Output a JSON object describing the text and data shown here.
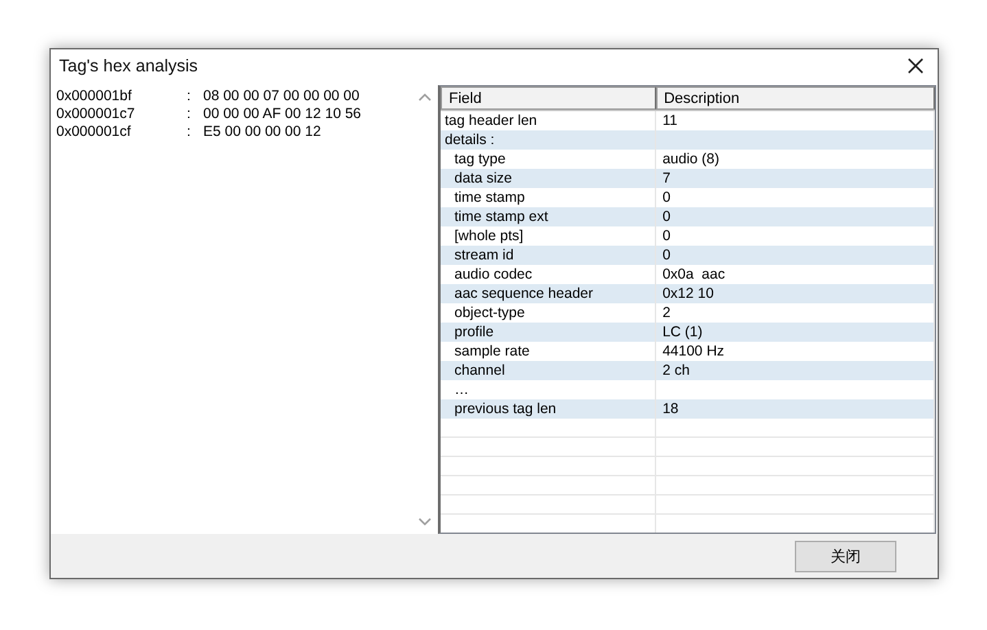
{
  "window": {
    "title": "Tag's hex analysis"
  },
  "hex_lines": [
    {
      "address": "0x000001bf",
      "separator": ":",
      "bytes": "08 00 00 07 00 00 00 00"
    },
    {
      "address": "0x000001c7",
      "separator": ":",
      "bytes": "00 00 00 AF 00 12 10 56"
    },
    {
      "address": "0x000001cf",
      "separator": ":",
      "bytes": "E5 00 00 00 00 12"
    }
  ],
  "table": {
    "columns": [
      "Field",
      "Description"
    ],
    "rows": [
      {
        "field": "tag header len",
        "description": "11"
      },
      {
        "field": "details :",
        "children": [
          {
            "field": "tag type",
            "description": "audio (8)"
          },
          {
            "field": "data size",
            "description": "7"
          },
          {
            "field": "time stamp",
            "description": "0"
          },
          {
            "field": "time stamp ext",
            "description": "0"
          },
          {
            "field": "[whole pts]",
            "description": "0"
          },
          {
            "field": "stream id",
            "description": "0"
          },
          {
            "field": "audio codec",
            "description": "0x0a  aac"
          },
          {
            "field": "aac sequence header",
            "description": "0x12 10"
          },
          {
            "field": "object-type",
            "description": "2"
          },
          {
            "field": "profile",
            "description": "LC (1)"
          },
          {
            "field": "sample rate",
            "description": "44100 Hz"
          },
          {
            "field": "channel",
            "description": "2 ch"
          },
          {
            "field": "…"
          },
          {
            "field": "previous tag len",
            "description": "18"
          }
        ]
      }
    ]
  },
  "buttons": [
    "关闭"
  ]
}
